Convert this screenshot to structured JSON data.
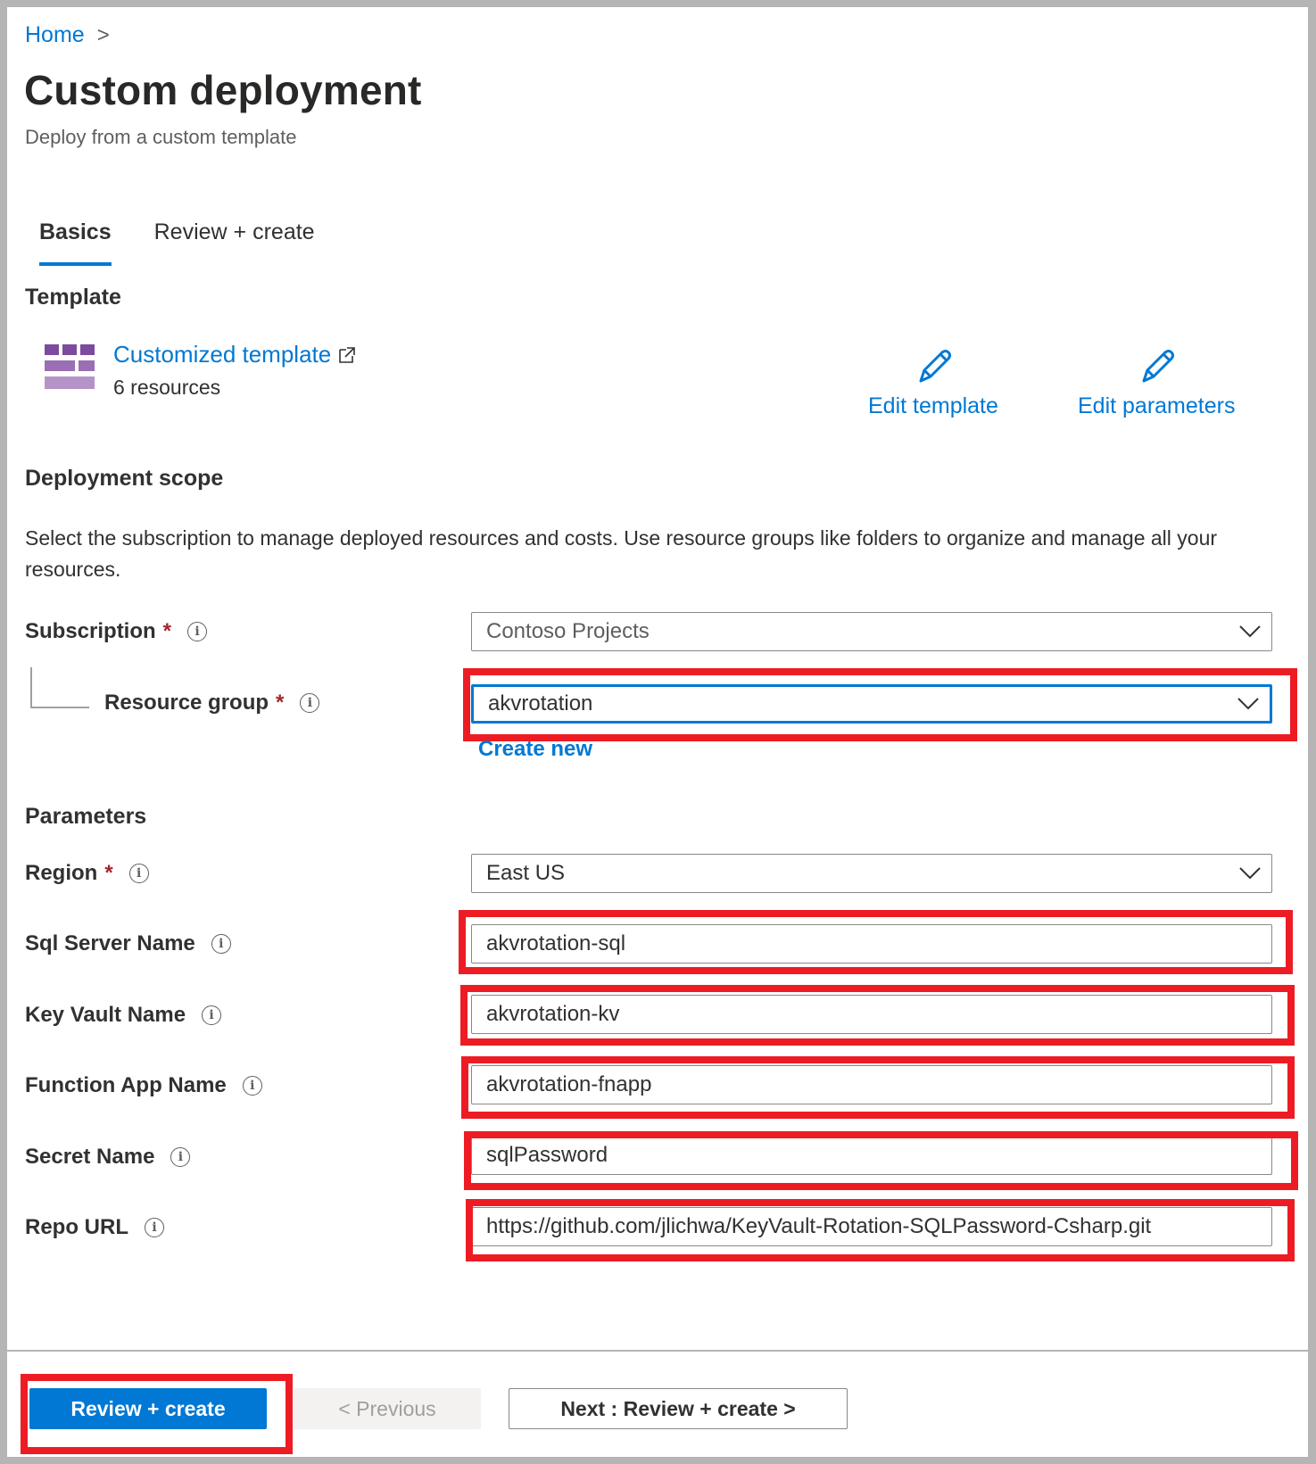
{
  "breadcrumb": {
    "home": "Home",
    "separator": ">"
  },
  "header": {
    "title": "Custom deployment",
    "subtitle": "Deploy from a custom template"
  },
  "tabs": [
    {
      "label": "Basics",
      "active": true
    },
    {
      "label": "Review + create",
      "active": false
    }
  ],
  "template": {
    "heading": "Template",
    "link_label": "Customized template",
    "resource_count": "6 resources",
    "edit_template": "Edit template",
    "edit_parameters": "Edit parameters"
  },
  "deployment_scope": {
    "heading": "Deployment scope",
    "description": "Select the subscription to manage deployed resources and costs. Use resource groups like folders to organize and manage all your resources.",
    "subscription": {
      "label": "Subscription",
      "required": "*",
      "value": "Contoso Projects"
    },
    "resource_group": {
      "label": "Resource group",
      "required": "*",
      "value": "akvrotation",
      "create_new": "Create new"
    }
  },
  "parameters": {
    "heading": "Parameters",
    "region": {
      "label": "Region",
      "required": "*",
      "value": "East US"
    },
    "sql_server_name": {
      "label": "Sql Server Name",
      "value": "akvrotation-sql"
    },
    "key_vault_name": {
      "label": "Key Vault Name",
      "value": "akvrotation-kv"
    },
    "function_app_name": {
      "label": "Function App Name",
      "value": "akvrotation-fnapp"
    },
    "secret_name": {
      "label": "Secret Name",
      "value": "sqlPassword"
    },
    "repo_url": {
      "label": "Repo URL",
      "value": "https://github.com/jlichwa/KeyVault-Rotation-SQLPassword-Csharp.git"
    }
  },
  "footer": {
    "review_create": "Review + create",
    "previous": "< Previous",
    "next": "Next : Review + create >"
  },
  "colors": {
    "accent": "#0078d4",
    "highlight": "#ed1c24",
    "required": "#a4262c"
  }
}
